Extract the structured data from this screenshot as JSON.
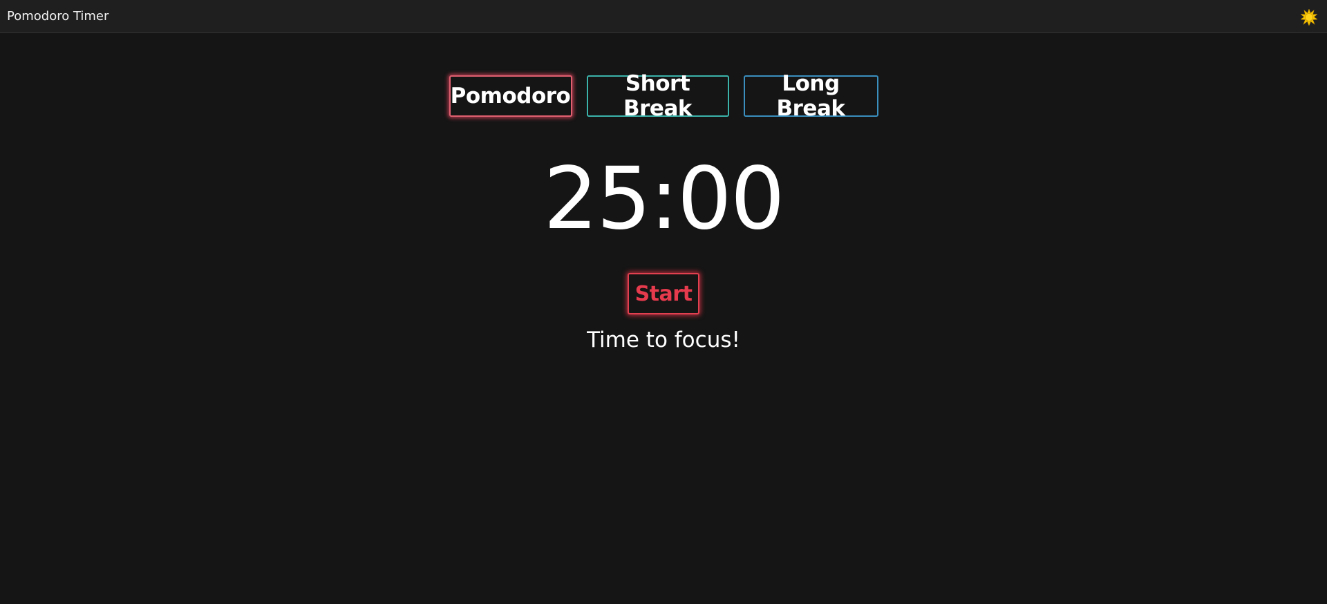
{
  "app": {
    "title": "Pomodoro Timer",
    "theme_icon": "sun-icon"
  },
  "modes": {
    "tabs": [
      {
        "label": "Pomodoro",
        "active": true,
        "accent": "#e06070"
      },
      {
        "label": "Short Break",
        "active": false,
        "accent": "#3bb3ab"
      },
      {
        "label": "Long Break",
        "active": false,
        "accent": "#3a8fbf"
      }
    ]
  },
  "timer": {
    "display": "25:00"
  },
  "controls": {
    "start_label": "Start",
    "start_color": "#e63a4d"
  },
  "status": {
    "message": "Time to focus!"
  },
  "colors": {
    "background": "#151515",
    "titlebar": "#1f1f1f",
    "sun": "#f5c400"
  }
}
